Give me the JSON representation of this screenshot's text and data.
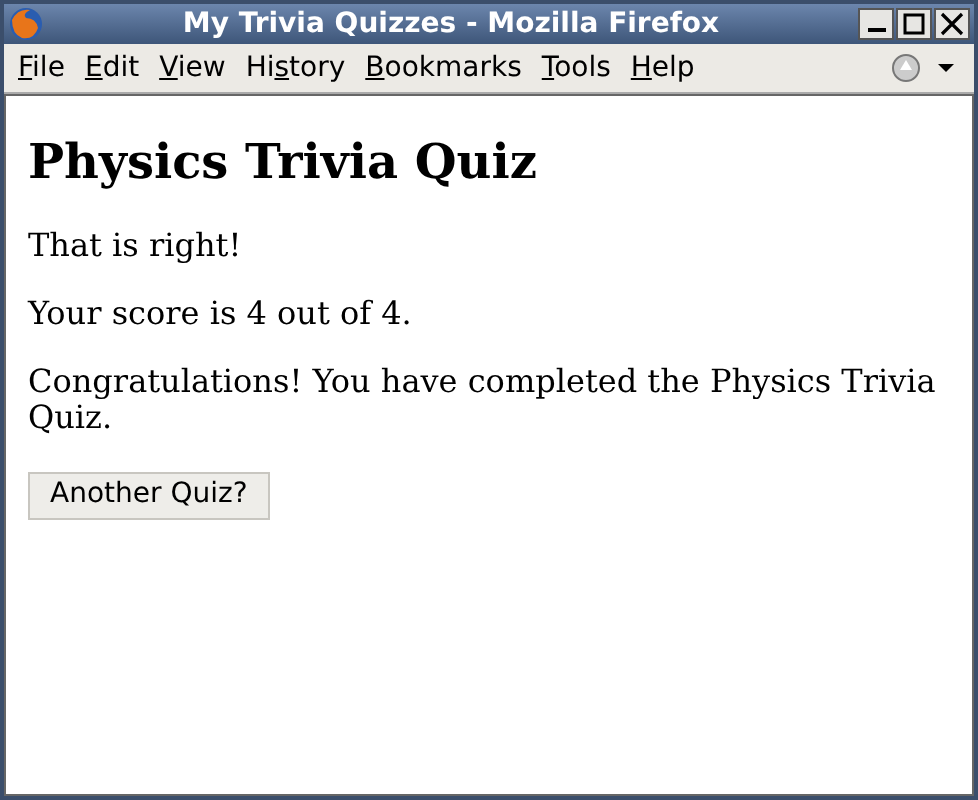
{
  "window": {
    "title": "My Trivia Quizzes - Mozilla Firefox"
  },
  "menu": [
    {
      "key": "F",
      "after": "ile"
    },
    {
      "key": "E",
      "after": "dit"
    },
    {
      "key": "V",
      "after": "iew"
    },
    {
      "before": "Hi",
      "key": "s",
      "after": "tory"
    },
    {
      "key": "B",
      "after": "ookmarks"
    },
    {
      "key": "T",
      "after": "ools"
    },
    {
      "key": "H",
      "after": "elp"
    }
  ],
  "page": {
    "heading": "Physics Trivia Quiz",
    "paragraphs": [
      "That is right!",
      "Your score is 4 out of 4.",
      "Congratulations! You have completed the Physics Trivia Quiz."
    ],
    "button": "Another Quiz?"
  }
}
